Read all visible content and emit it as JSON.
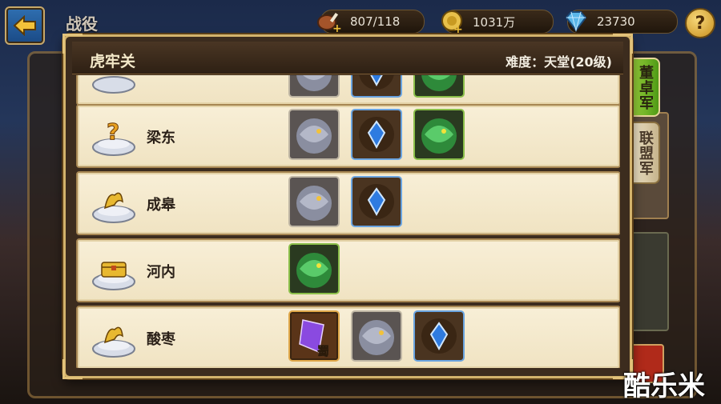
{
  "top_bar": {
    "back_label": "",
    "page_title": "战役",
    "resources": [
      {
        "icon": "meat-icon",
        "value": "807/118"
      },
      {
        "icon": "coin-icon",
        "value": "1031万"
      },
      {
        "icon": "diamond-icon",
        "value": "23730"
      }
    ],
    "help_label": "?"
  },
  "side_tabs": [
    {
      "label": "董卓军",
      "active": true
    },
    {
      "label": "联盟军",
      "active": false
    }
  ],
  "modal": {
    "title": "虎牢关",
    "difficulty": "难度：天堂(20级)",
    "stages": [
      {
        "name": "",
        "pedestal_icon": "",
        "rewards": [
          "grey-beast-icon",
          "blue-gem-icon",
          "green-beast-icon"
        ],
        "partial": true
      },
      {
        "name": "梁东",
        "pedestal_icon": "question-mark-icon",
        "rewards": [
          "grey-beast-icon",
          "blue-gem-icon",
          "green-beast-icon"
        ]
      },
      {
        "name": "成皋",
        "pedestal_icon": "golden-ornament-icon",
        "rewards": [
          "grey-beast-icon",
          "blue-gem-icon"
        ]
      },
      {
        "name": "河内",
        "pedestal_icon": "treasure-chest-icon",
        "rewards": [
          "green-beast-icon"
        ]
      },
      {
        "name": "酸枣",
        "pedestal_icon": "golden-ornament-icon",
        "rewards": [
          "purple-crystal-shu-icon",
          "grey-beast-icon",
          "blue-gem-icon"
        ]
      }
    ],
    "shu_label": "蜀"
  },
  "watermark": "酷乐米",
  "colors": {
    "frame_gold": "#d3b36c",
    "row_bg": "#f5ead0",
    "active_tab": "#7ac22a",
    "blue_slot": "#6aa4e0",
    "green_slot": "#8bbf4a"
  }
}
